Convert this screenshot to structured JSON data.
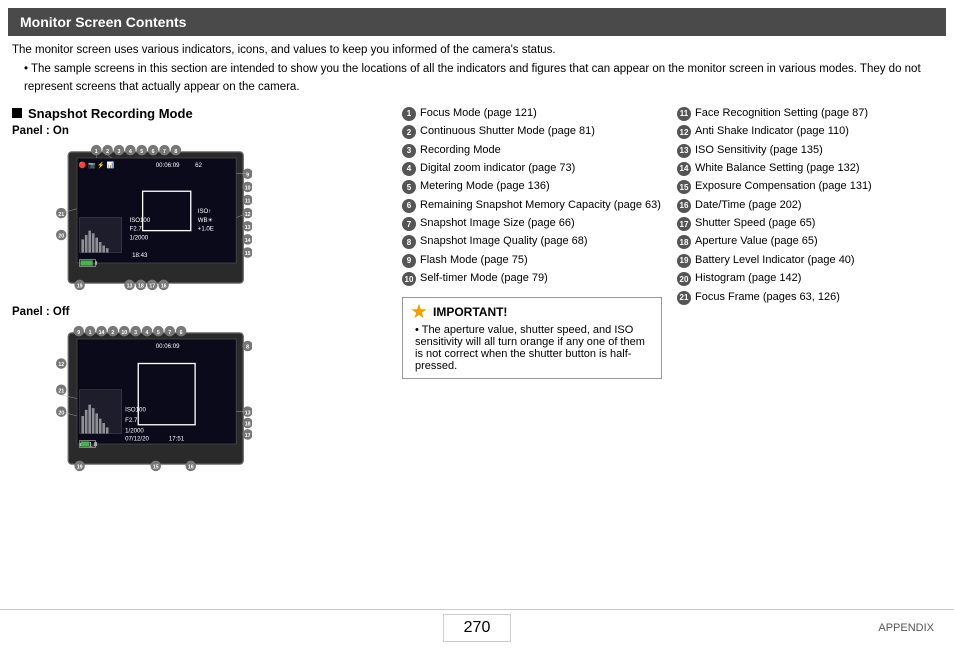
{
  "header": {
    "title": "Monitor Screen Contents"
  },
  "intro": {
    "line1": "The monitor screen uses various indicators, icons, and values to keep you informed of the camera's status.",
    "line2": "The sample screens in this section are intended to show you the locations of all the indicators and figures that can appear on the monitor screen in various modes. They do not represent screens that actually appear on the camera."
  },
  "section": {
    "title": "Snapshot Recording Mode",
    "panel_on": "Panel : On",
    "panel_off": "Panel : Off"
  },
  "items_col1": [
    {
      "num": "1",
      "text": "Focus Mode (page 121)"
    },
    {
      "num": "2",
      "text": "Continuous Shutter Mode (page 81)"
    },
    {
      "num": "3",
      "text": "Recording Mode"
    },
    {
      "num": "4",
      "text": "Digital zoom indicator (page 73)"
    },
    {
      "num": "5",
      "text": "Metering Mode (page 136)"
    },
    {
      "num": "6",
      "text": "Remaining Snapshot Memory Capacity (page 63)"
    },
    {
      "num": "7",
      "text": "Snapshot Image Size (page 66)"
    },
    {
      "num": "8",
      "text": "Snapshot Image Quality (page 68)"
    },
    {
      "num": "9",
      "text": "Flash Mode (page 75)"
    },
    {
      "num": "10",
      "text": "Self-timer Mode (page 79)"
    }
  ],
  "items_col2": [
    {
      "num": "11",
      "text": "Face Recognition Setting (page 87)"
    },
    {
      "num": "12",
      "text": "Anti Shake Indicator (page 110)"
    },
    {
      "num": "13",
      "text": "ISO Sensitivity (page 135)"
    },
    {
      "num": "14",
      "text": "White Balance Setting (page 132)"
    },
    {
      "num": "15",
      "text": "Exposure Compensation (page 131)"
    },
    {
      "num": "16",
      "text": "Date/Time (page 202)"
    },
    {
      "num": "17",
      "text": "Shutter Speed (page 65)"
    },
    {
      "num": "18",
      "text": "Aperture Value (page 65)"
    },
    {
      "num": "19",
      "text": "Battery Level Indicator (page 40)"
    },
    {
      "num": "20",
      "text": "Histogram (page 142)"
    },
    {
      "num": "21",
      "text": "Focus Frame (pages 63, 126)"
    }
  ],
  "important": {
    "title": "IMPORTANT!",
    "text": "The aperture value, shutter speed, and ISO sensitivity will all turn orange if any one of them is not correct when the shutter button is half-pressed."
  },
  "footer": {
    "page": "270",
    "label": "APPENDIX"
  }
}
